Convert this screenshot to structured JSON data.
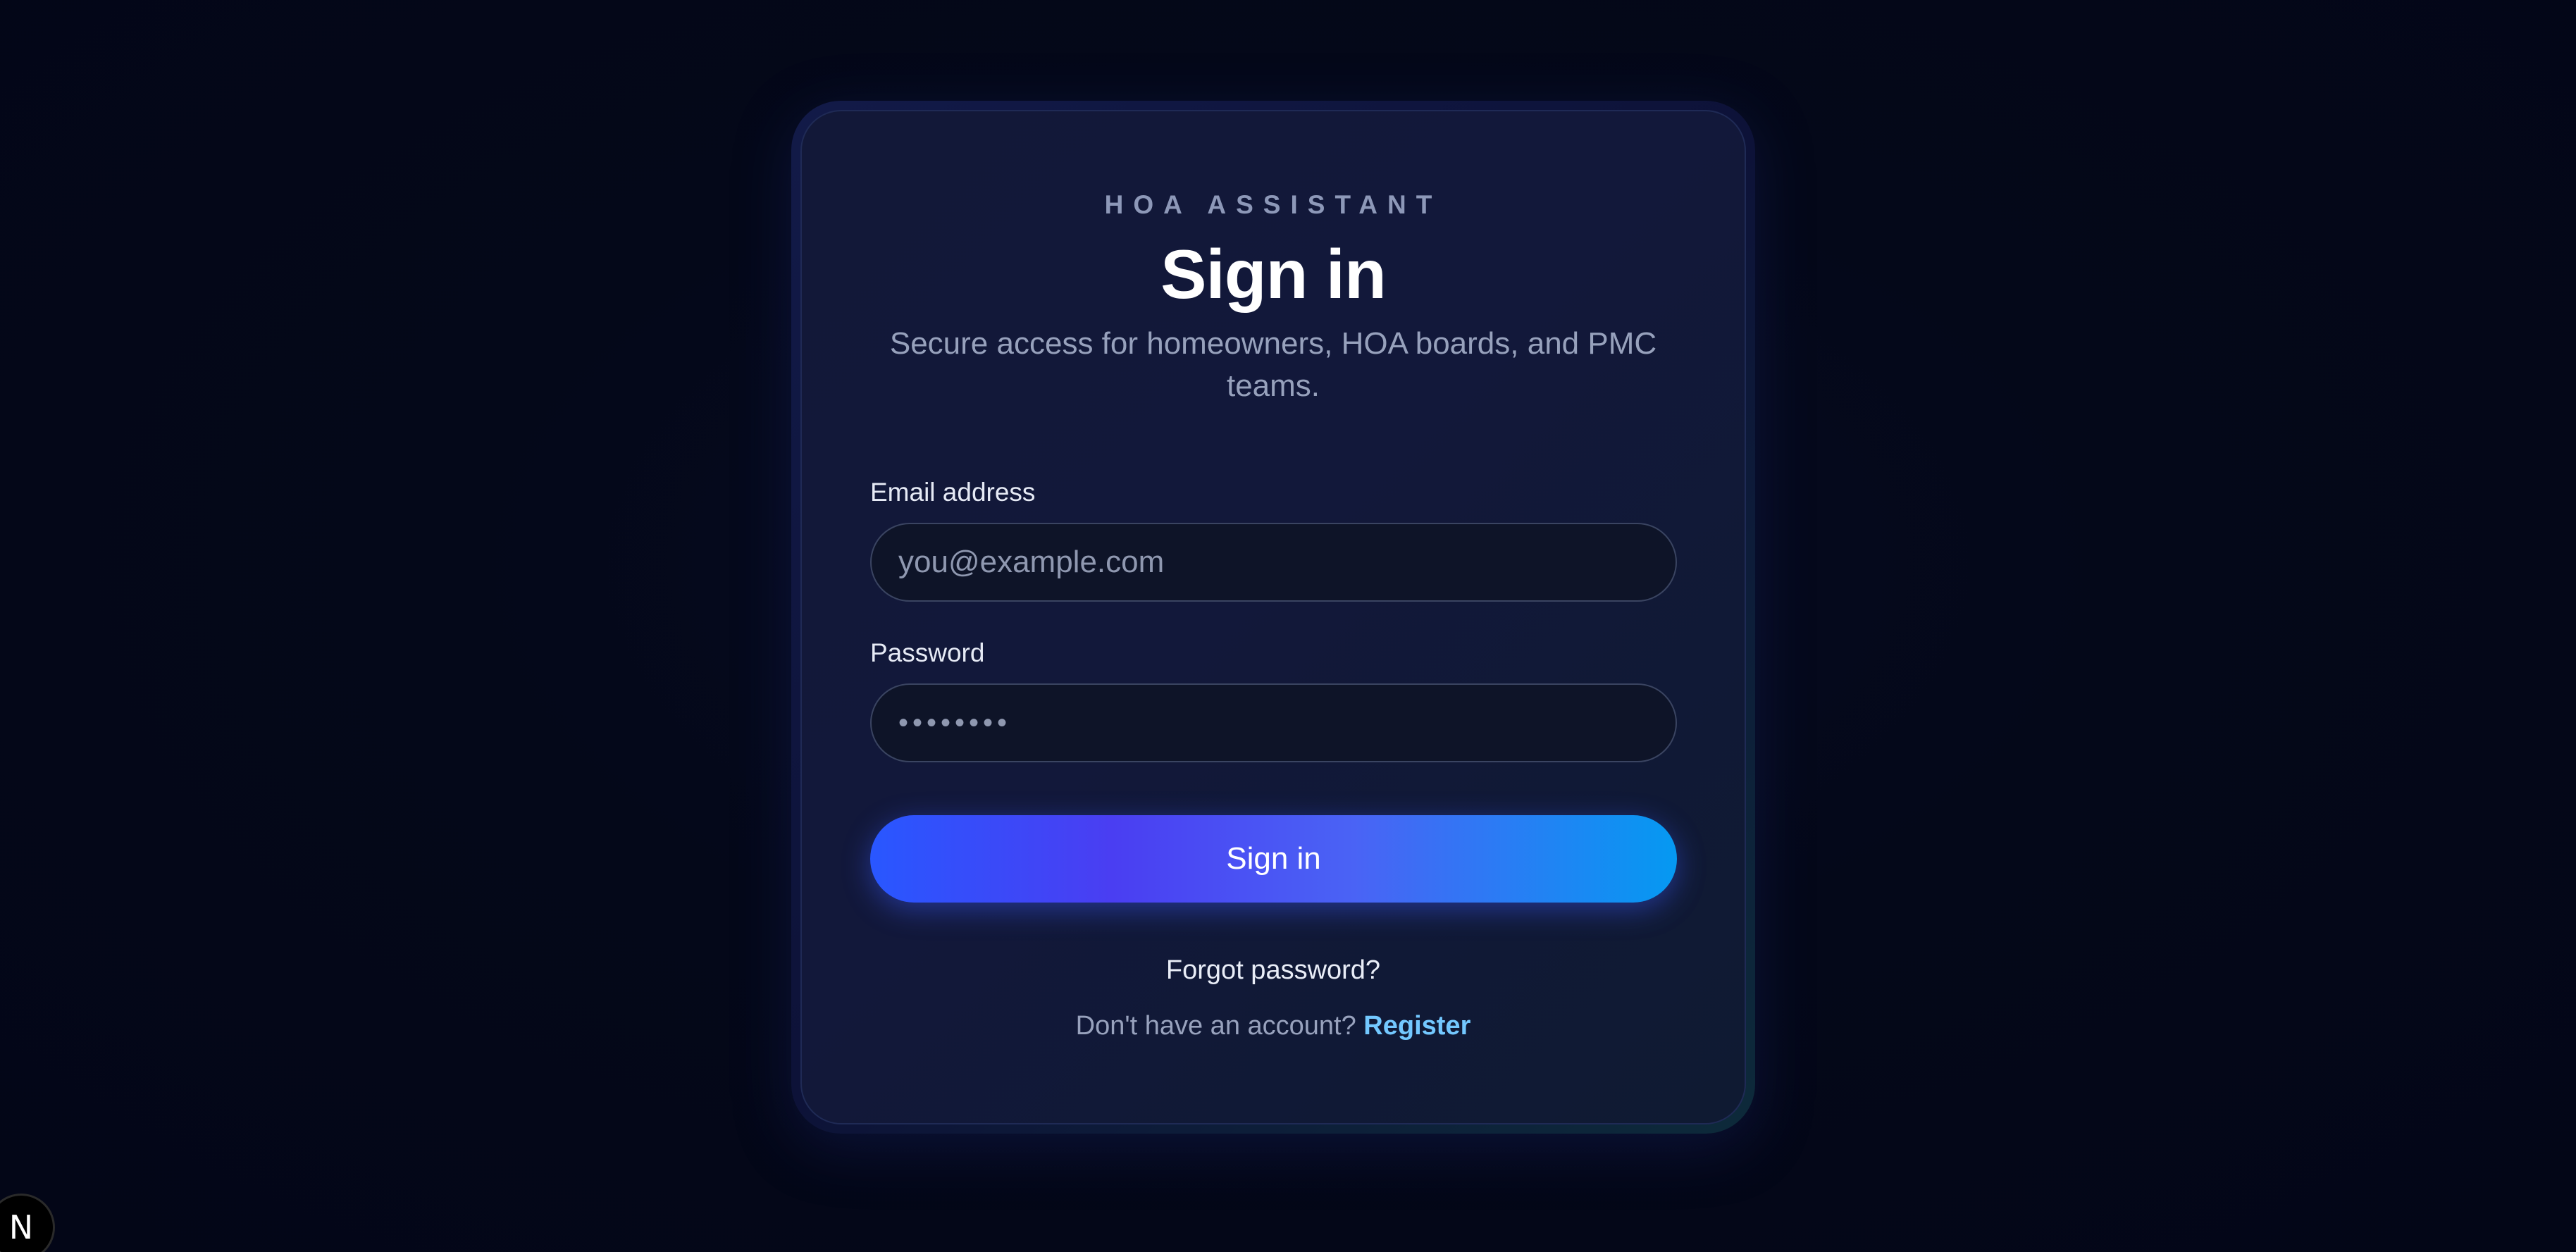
{
  "brand": "HOA ASSISTANT",
  "title": "Sign in",
  "subtitle": "Secure access for homeowners, HOA boards, and PMC teams.",
  "form": {
    "email_label": "Email address",
    "email_placeholder": "you@example.com",
    "password_label": "Password",
    "password_value": "••••••••",
    "submit_label": "Sign in"
  },
  "links": {
    "forgot_password": "Forgot password?",
    "no_account_text": "Don't have an account?",
    "register": "Register"
  },
  "badge": {
    "letter": "N",
    "icon": "nextjs-icon"
  },
  "colors": {
    "background": "#030617",
    "accent_gradient_start": "#2957ff",
    "accent_gradient_mid": "#4a3ef2",
    "accent_gradient_end": "#0599f2",
    "link": "#73c8ff"
  }
}
